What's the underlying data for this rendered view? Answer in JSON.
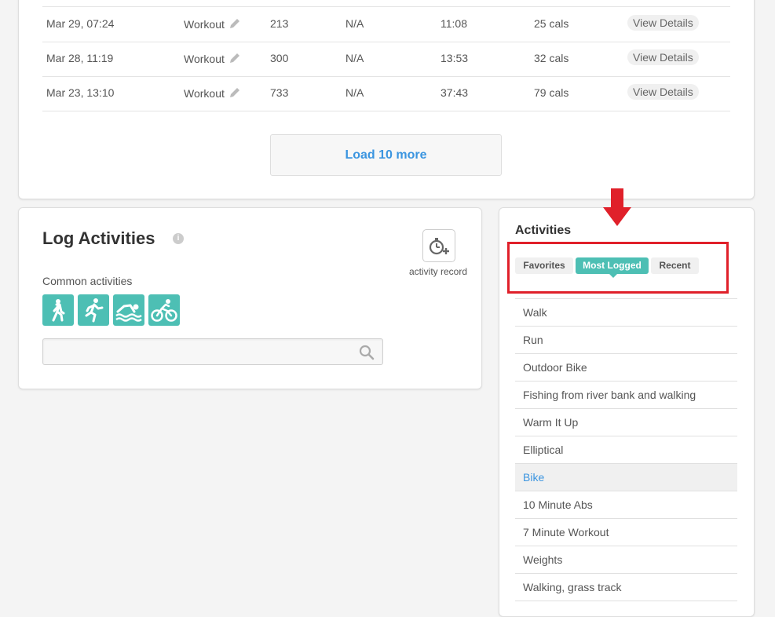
{
  "history": {
    "rows": [
      {
        "date": "Mar 29, 07:24",
        "name": "Workout",
        "steps": "213",
        "distance": "N/A",
        "duration": "11:08",
        "calories": "25 cals",
        "action": "View Details"
      },
      {
        "date": "Mar 28, 11:19",
        "name": "Workout",
        "steps": "300",
        "distance": "N/A",
        "duration": "13:53",
        "calories": "32 cals",
        "action": "View Details"
      },
      {
        "date": "Mar 23, 13:10",
        "name": "Workout",
        "steps": "733",
        "distance": "N/A",
        "duration": "37:43",
        "calories": "79 cals",
        "action": "View Details"
      }
    ],
    "load_more_label": "Load 10 more"
  },
  "log": {
    "title": "Log Activities",
    "info_icon": "info-icon",
    "record_label": "activity record",
    "common_label": "Common activities",
    "common_icons": [
      "walk-icon",
      "run-icon",
      "swim-icon",
      "bike-icon"
    ],
    "search_placeholder": ""
  },
  "activities": {
    "title": "Activities",
    "tabs": [
      "Favorites",
      "Most Logged",
      "Recent"
    ],
    "active_tab": "Most Logged",
    "items": [
      "Walk",
      "Run",
      "Outdoor Bike",
      "Fishing from river bank and walking",
      "Warm It Up",
      "Elliptical",
      "Bike",
      "10 Minute Abs",
      "7 Minute Workout",
      "Weights",
      "Walking, grass track"
    ],
    "selected_item": "Bike"
  },
  "colors": {
    "accent": "#4dbfb4",
    "link": "#3b95e0",
    "annotation": "#e0202a"
  }
}
